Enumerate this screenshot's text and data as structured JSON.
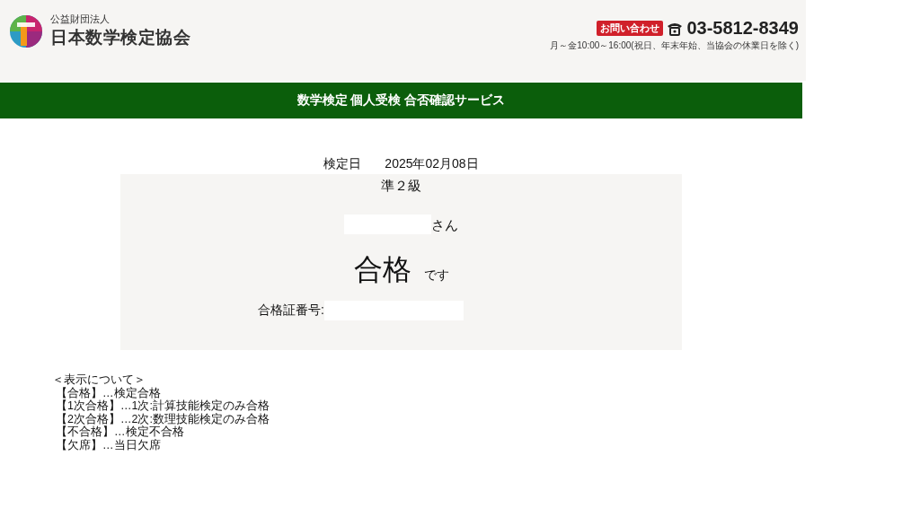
{
  "header": {
    "org_type": "公益財団法人",
    "org_name": "日本数学検定協会",
    "contact_badge": "お問い合わせ",
    "phone": "03-5812-8349",
    "hours": "月～金10:00～16:00(祝日、年末年始、当協会の休業日を除く)"
  },
  "banner": {
    "title": "数学検定 個人受検 合否確認サービス"
  },
  "result": {
    "date_label": "検定日",
    "date": "2025年02月08日",
    "grade": "準２級",
    "name_suffix": "さん",
    "verdict": "合格",
    "verdict_suffix": "です",
    "certificate_label": "合格証番号:"
  },
  "legend": {
    "title": "＜表示について＞",
    "items": [
      "【合格】…検定合格",
      "【1次合格】…1次:計算技能検定のみ合格",
      "【2次合格】…2次:数理技能検定のみ合格",
      "【不合格】…検定不合格",
      "【欠席】…当日欠席"
    ]
  }
}
